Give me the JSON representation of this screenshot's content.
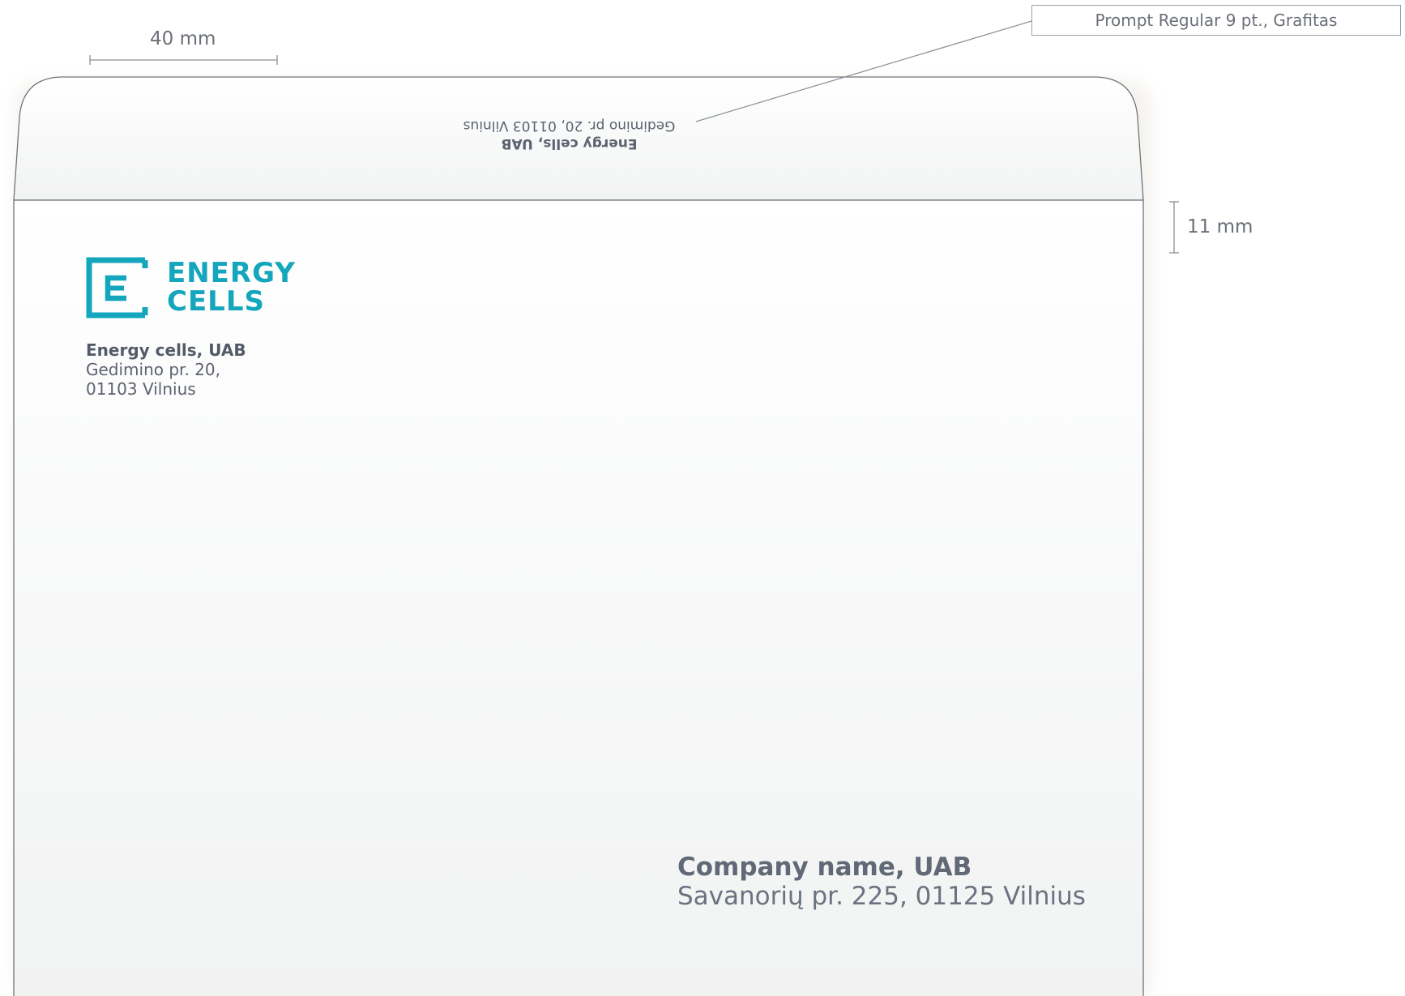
{
  "dimensions": {
    "flap_margin_label": "40 mm",
    "fold_offset_label": "11 mm"
  },
  "annotation": {
    "font_spec": "Prompt Regular 9 pt., Grafitas"
  },
  "flap_return_address": {
    "company": "Energy cells, UAB",
    "address": "Gedimino pr. 20, 01103 Vilnius"
  },
  "logo": {
    "line1": "ENERGY",
    "line2": "CELLS",
    "color": "#14a6bc"
  },
  "sender": {
    "company": "Energy cells, UAB",
    "address_line1": "Gedimino pr. 20,",
    "address_line2": "01103 Vilnius"
  },
  "recipient": {
    "company": "Company name, UAB",
    "address": "Savanorių pr. 225, 01125 Vilnius"
  }
}
